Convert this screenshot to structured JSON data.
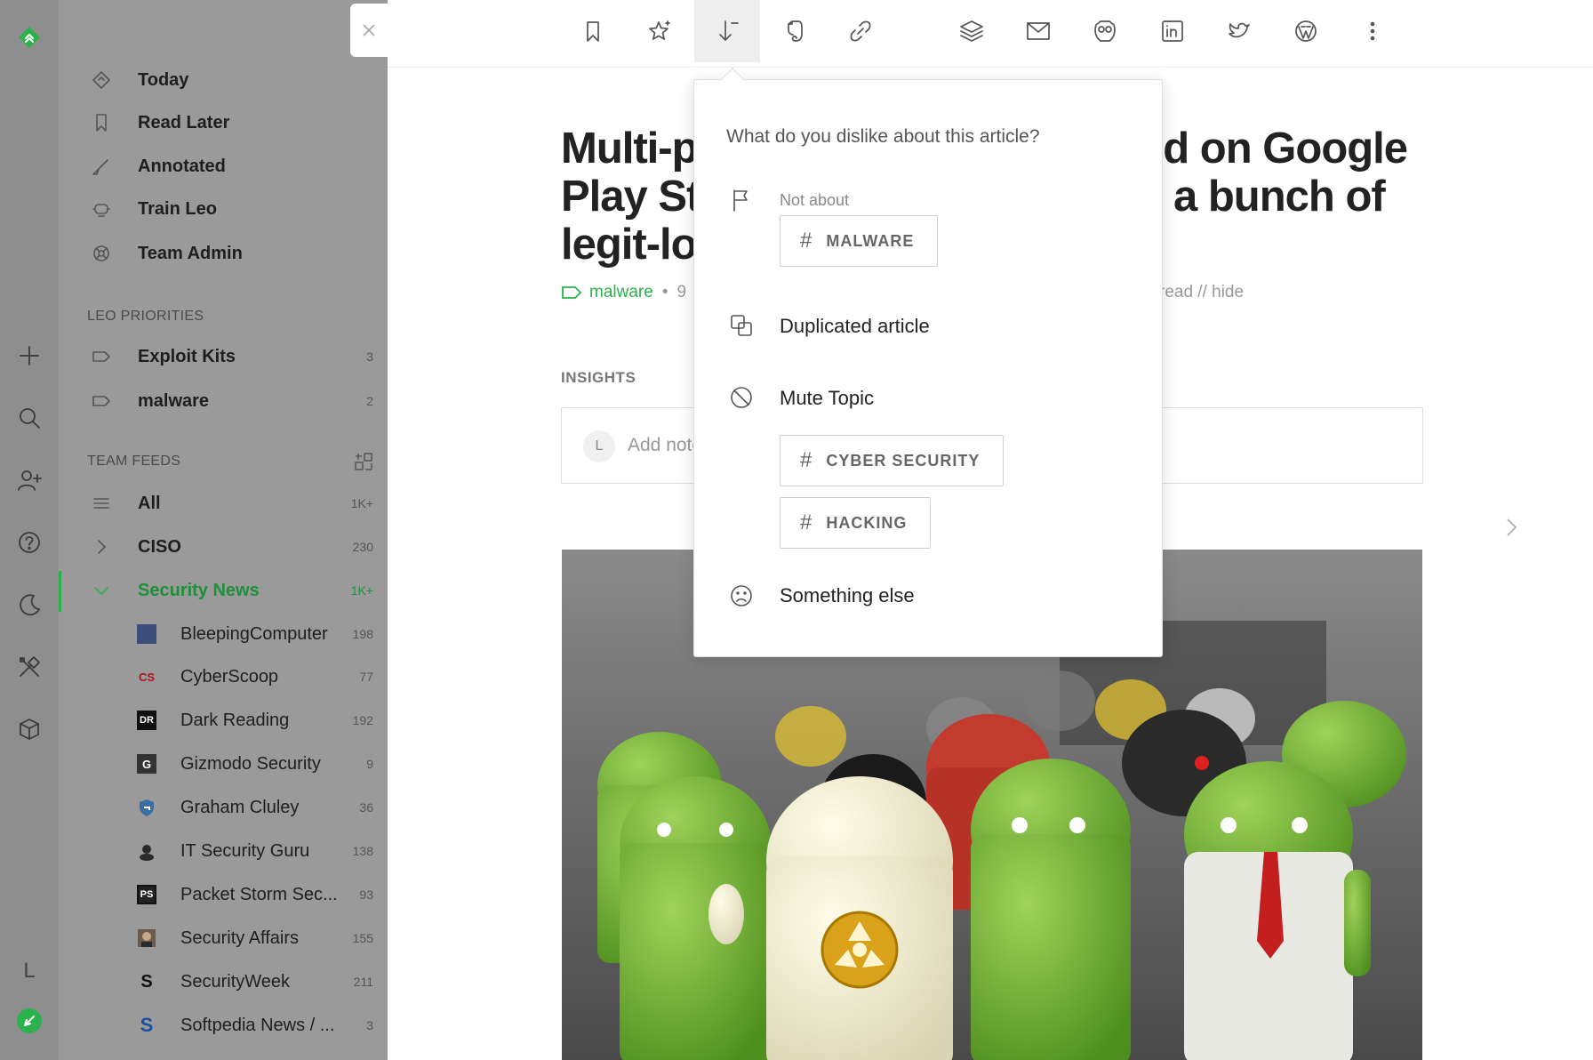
{
  "sidebar": {
    "nav": [
      {
        "label": "Today",
        "icon": "today-icon"
      },
      {
        "label": "Read Later",
        "icon": "bookmark-icon"
      },
      {
        "label": "Annotated",
        "icon": "highlighter-icon"
      },
      {
        "label": "Train Leo",
        "icon": "leo-icon"
      },
      {
        "label": "Team Admin",
        "icon": "team-icon"
      }
    ],
    "leo_heading": "LEO PRIORITIES",
    "priorities": [
      {
        "label": "Exploit Kits",
        "count": "3"
      },
      {
        "label": "malware",
        "count": "2"
      }
    ],
    "team_heading": "TEAM FEEDS",
    "team_feeds": [
      {
        "label": "All",
        "count": "1K+"
      },
      {
        "label": "CISO",
        "count": "230"
      },
      {
        "label": "Security News",
        "count": "1K+"
      }
    ],
    "sources": [
      {
        "label": "BleepingComputer",
        "count": "198",
        "badge": ""
      },
      {
        "label": "CyberScoop",
        "count": "77",
        "badge": "CS"
      },
      {
        "label": "Dark Reading",
        "count": "192",
        "badge": "DR"
      },
      {
        "label": "Gizmodo Security",
        "count": "9",
        "badge": "G"
      },
      {
        "label": "Graham Cluley",
        "count": "36",
        "badge": ""
      },
      {
        "label": "IT Security Guru",
        "count": "138",
        "badge": ""
      },
      {
        "label": "Packet Storm Sec...",
        "count": "93",
        "badge": "PS"
      },
      {
        "label": "Security Affairs",
        "count": "155",
        "badge": ""
      },
      {
        "label": "SecurityWeek",
        "count": "211",
        "badge": "S"
      },
      {
        "label": "Softpedia News / ...",
        "count": "3",
        "badge": "S"
      }
    ],
    "user_initial": "L"
  },
  "article": {
    "title_line1_left": "Multi-pa",
    "title_line1_right": "ed on Google",
    "title_line2_left": "Play St",
    "title_line2_right": "a bunch of",
    "title_line3_left": "legit-loo",
    "tag": "malware",
    "meta_dot": "•",
    "meta_partial": "9",
    "meta_right": "read  //  hide",
    "insights_label": "INSIGHTS",
    "note_initial": "L",
    "note_placeholder": "Add note"
  },
  "popover": {
    "question": "What do you dislike about this article?",
    "not_about_label": "Not about",
    "not_about_tags": [
      "MALWARE"
    ],
    "duplicated": "Duplicated article",
    "mute_topic": "Mute Topic",
    "mute_tags": [
      "CYBER SECURITY",
      "HACKING"
    ],
    "something_else": "Something else",
    "hash": "#"
  },
  "colors": {
    "accent": "#2bb24c",
    "sidebar_bg": "#9a9a9a",
    "rail_bg": "#8e8e8e"
  }
}
